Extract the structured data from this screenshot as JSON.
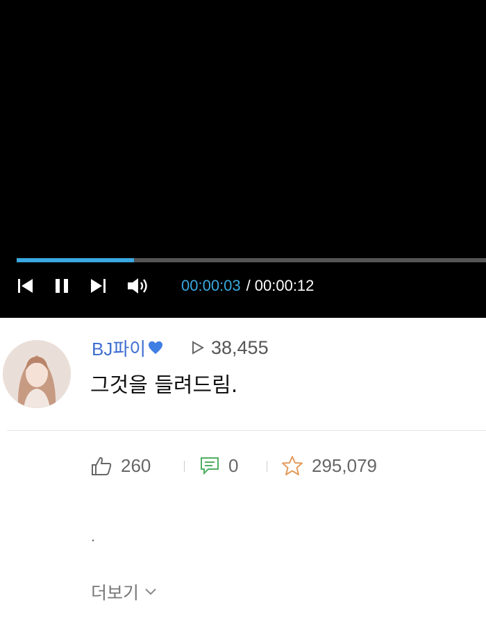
{
  "player": {
    "progress": 0.25,
    "current_time": "00:00:03",
    "separator": "/",
    "total_time": "00:00:12",
    "accent_color": "#3aa8e0",
    "controls": [
      "skip-back-icon",
      "pause-icon",
      "skip-forward-icon",
      "volume-icon"
    ]
  },
  "post": {
    "author": "BJ파이",
    "author_badge": "heart-icon",
    "views": "38,455",
    "title": "그것을 들려드림.",
    "body_text": "."
  },
  "stats": {
    "likes": "260",
    "comments": "0",
    "stars": "295,079"
  },
  "more_label": "더보기"
}
